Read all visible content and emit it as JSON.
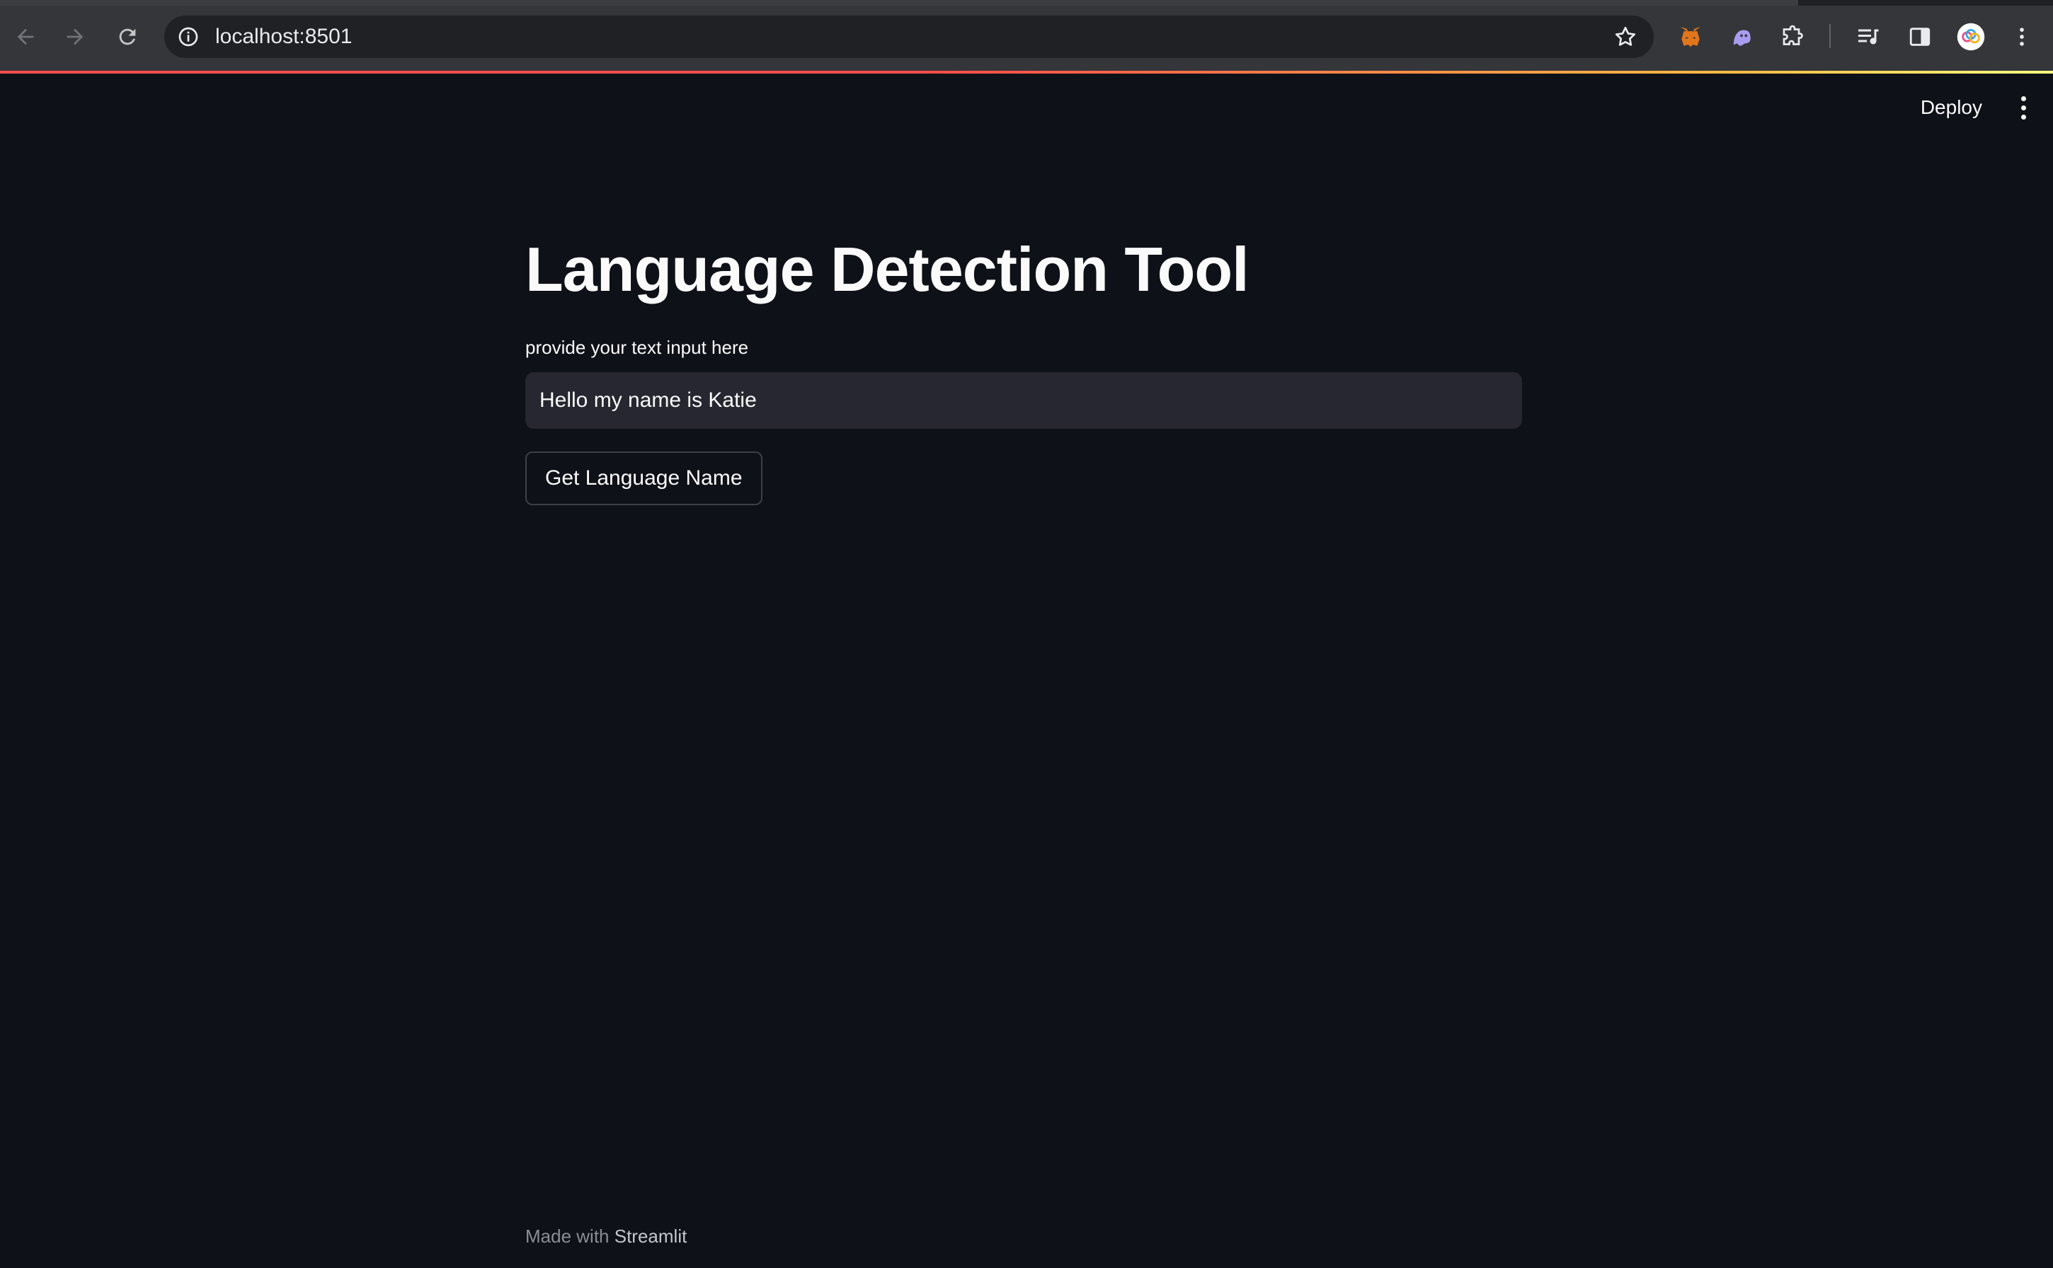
{
  "browser": {
    "url": "localhost:8501",
    "icons": {
      "back": "back-arrow-icon",
      "forward": "forward-arrow-icon",
      "reload": "reload-icon",
      "site_info": "info-icon",
      "bookmark": "star-icon",
      "extensions": [
        "metamask-fox-icon",
        "ghost-extension-icon",
        "puzzle-extensions-icon",
        "media-queue-icon",
        "side-panel-icon",
        "profile-avatar-icon",
        "kebab-menu-icon"
      ]
    },
    "accent_gradient": [
      "#ff4b4b",
      "#ffbd45",
      "#fffd80"
    ]
  },
  "app": {
    "header": {
      "deploy_label": "Deploy"
    },
    "title": "Language Detection Tool",
    "input": {
      "label": "provide your text input here",
      "value": "Hello my name is Katie"
    },
    "button_label": "Get Language Name",
    "footer": {
      "prefix": "Made with",
      "brand": "Streamlit"
    },
    "colors": {
      "background": "#0e1117",
      "input_background": "#262730",
      "text": "#fafafa"
    }
  }
}
